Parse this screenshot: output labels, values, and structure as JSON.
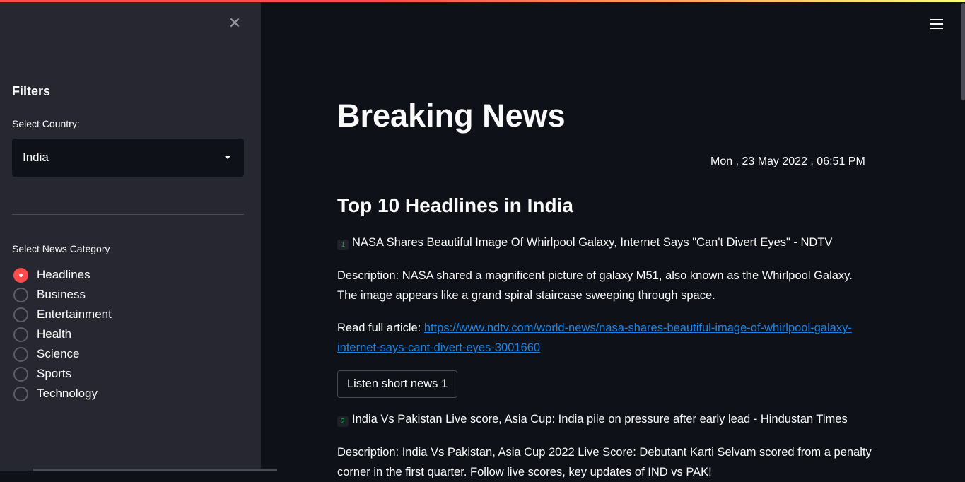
{
  "sidebar": {
    "close_symbol": "✕",
    "filters_title": "Filters",
    "country_label": "Select Country:",
    "country_value": "India",
    "category_label": "Select News Category",
    "categories": [
      {
        "label": "Headlines",
        "selected": true
      },
      {
        "label": "Business",
        "selected": false
      },
      {
        "label": "Entertainment",
        "selected": false
      },
      {
        "label": "Health",
        "selected": false
      },
      {
        "label": "Science",
        "selected": false
      },
      {
        "label": "Sports",
        "selected": false
      },
      {
        "label": "Technology",
        "selected": false
      }
    ]
  },
  "main": {
    "title": "Breaking News",
    "datetime": "Mon , 23 May 2022 , 06:51 PM",
    "section_title": "Top 10 Headlines in India",
    "articles": [
      {
        "number": "1",
        "headline": "NASA Shares Beautiful Image Of Whirlpool Galaxy, Internet Says \"Can't Divert Eyes\" - NDTV",
        "description": "Description: NASA shared a magnificent picture of galaxy M51, also known as the Whirlpool Galaxy. The image appears like a grand spiral staircase sweeping through space.",
        "read_label": "Read full article: ",
        "url": "https://www.ndtv.com/world-news/nasa-shares-beautiful-image-of-whirlpool-galaxy-internet-says-cant-divert-eyes-3001660",
        "button_label": "Listen short news 1"
      },
      {
        "number": "2",
        "headline": "India Vs Pakistan Live score, Asia Cup: India pile on pressure after early lead - Hindustan Times",
        "description": "Description: India Vs Pakistan, Asia Cup 2022 Live Score: Debutant Karti Selvam scored from a penalty corner in the first quarter. Follow live scores, key updates of IND vs PAK!"
      }
    ]
  },
  "colors": {
    "accent": "#ff4b4b",
    "link": "#1c83e1",
    "sidebar_bg": "#262730",
    "main_bg": "#0e1117"
  },
  "icons": {
    "close": "close-icon",
    "menu": "hamburger-menu-icon",
    "caret": "caret-down-icon"
  }
}
